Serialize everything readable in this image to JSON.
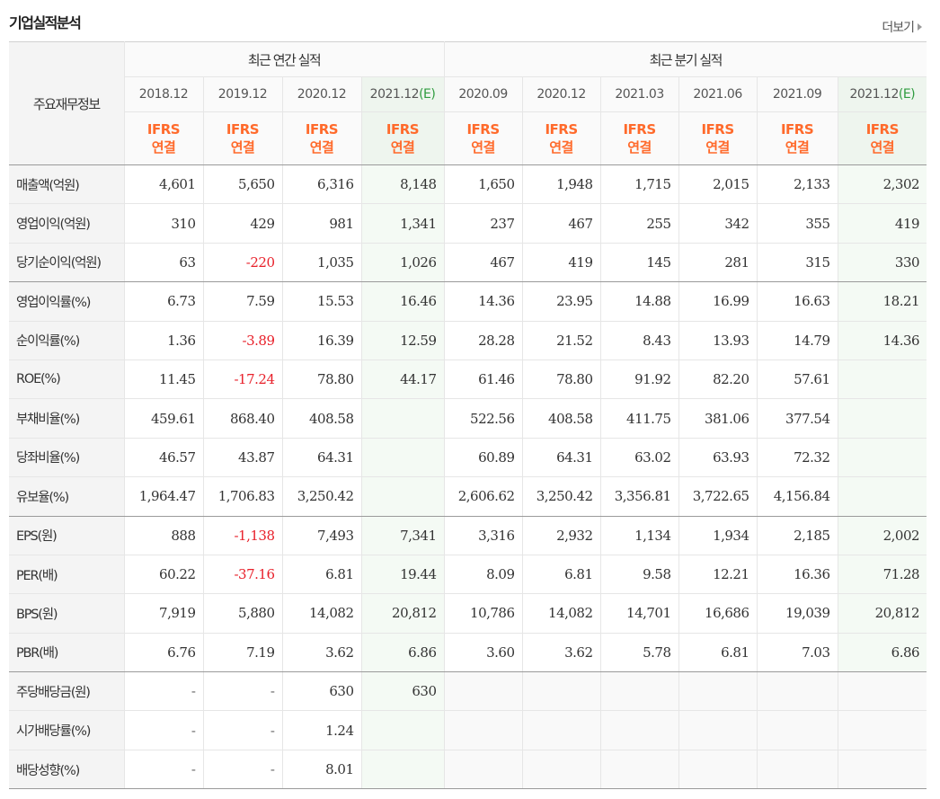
{
  "title": "기업실적분석",
  "more_label": "더보기",
  "header": {
    "label": "주요재무정보",
    "annual_group": "최근 연간 실적",
    "quarter_group": "최근 분기 실적",
    "annual_periods": [
      {
        "date": "2018.12",
        "est": ""
      },
      {
        "date": "2019.12",
        "est": ""
      },
      {
        "date": "2020.12",
        "est": ""
      },
      {
        "date": "2021.12",
        "est": "(E)"
      }
    ],
    "quarter_periods": [
      {
        "date": "2020.09",
        "est": ""
      },
      {
        "date": "2020.12",
        "est": ""
      },
      {
        "date": "2021.03",
        "est": ""
      },
      {
        "date": "2021.06",
        "est": ""
      },
      {
        "date": "2021.09",
        "est": ""
      },
      {
        "date": "2021.12",
        "est": "(E)"
      }
    ],
    "standard_line1": "IFRS",
    "standard_line2": "연결"
  },
  "rows": [
    {
      "label": "매출액(억원)",
      "values": [
        "4,601",
        "5,650",
        "6,316",
        "8,148",
        "1,650",
        "1,948",
        "1,715",
        "2,015",
        "2,133",
        "2,302"
      ]
    },
    {
      "label": "영업이익(억원)",
      "values": [
        "310",
        "429",
        "981",
        "1,341",
        "237",
        "467",
        "255",
        "342",
        "355",
        "419"
      ]
    },
    {
      "label": "당기순이익(억원)",
      "values": [
        "63",
        "-220",
        "1,035",
        "1,026",
        "467",
        "419",
        "145",
        "281",
        "315",
        "330"
      ],
      "group_end": true
    },
    {
      "label": "영업이익률(%)",
      "values": [
        "6.73",
        "7.59",
        "15.53",
        "16.46",
        "14.36",
        "23.95",
        "14.88",
        "16.99",
        "16.63",
        "18.21"
      ]
    },
    {
      "label": "순이익률(%)",
      "values": [
        "1.36",
        "-3.89",
        "16.39",
        "12.59",
        "28.28",
        "21.52",
        "8.43",
        "13.93",
        "14.79",
        "14.36"
      ]
    },
    {
      "label": "ROE(%)",
      "values": [
        "11.45",
        "-17.24",
        "78.80",
        "44.17",
        "61.46",
        "78.80",
        "91.92",
        "82.20",
        "57.61",
        ""
      ]
    },
    {
      "label": "부채비율(%)",
      "values": [
        "459.61",
        "868.40",
        "408.58",
        "",
        "522.56",
        "408.58",
        "411.75",
        "381.06",
        "377.54",
        ""
      ]
    },
    {
      "label": "당좌비율(%)",
      "values": [
        "46.57",
        "43.87",
        "64.31",
        "",
        "60.89",
        "64.31",
        "63.02",
        "63.93",
        "72.32",
        ""
      ]
    },
    {
      "label": "유보율(%)",
      "values": [
        "1,964.47",
        "1,706.83",
        "3,250.42",
        "",
        "2,606.62",
        "3,250.42",
        "3,356.81",
        "3,722.65",
        "4,156.84",
        ""
      ],
      "group_end": true
    },
    {
      "label": "EPS(원)",
      "values": [
        "888",
        "-1,138",
        "7,493",
        "7,341",
        "3,316",
        "2,932",
        "1,134",
        "1,934",
        "2,185",
        "2,002"
      ]
    },
    {
      "label": "PER(배)",
      "values": [
        "60.22",
        "-37.16",
        "6.81",
        "19.44",
        "8.09",
        "6.81",
        "9.58",
        "12.21",
        "16.36",
        "71.28"
      ]
    },
    {
      "label": "BPS(원)",
      "values": [
        "7,919",
        "5,880",
        "14,082",
        "20,812",
        "10,786",
        "14,082",
        "14,701",
        "16,686",
        "19,039",
        "20,812"
      ]
    },
    {
      "label": "PBR(배)",
      "values": [
        "6.76",
        "7.19",
        "3.62",
        "6.86",
        "3.60",
        "3.62",
        "5.78",
        "6.81",
        "7.03",
        "6.86"
      ],
      "group_end": true
    },
    {
      "label": "주당배당금(원)",
      "values": [
        "-",
        "-",
        "630",
        "630",
        "",
        "",
        "",
        "",
        "",
        ""
      ],
      "quarter_blank": true
    },
    {
      "label": "시가배당률(%)",
      "values": [
        "-",
        "-",
        "1.24",
        "",
        "",
        "",
        "",
        "",
        "",
        ""
      ],
      "quarter_blank": true
    },
    {
      "label": "배당성향(%)",
      "values": [
        "-",
        "-",
        "8.01",
        "",
        "",
        "",
        "",
        "",
        "",
        ""
      ],
      "quarter_blank": true
    }
  ],
  "colors": {
    "negative": "#e8202a",
    "accent_ifrs": "#ff6a2b",
    "estimate_mark": "#2f9c3f",
    "estimate_bg": "#f4faf4"
  }
}
